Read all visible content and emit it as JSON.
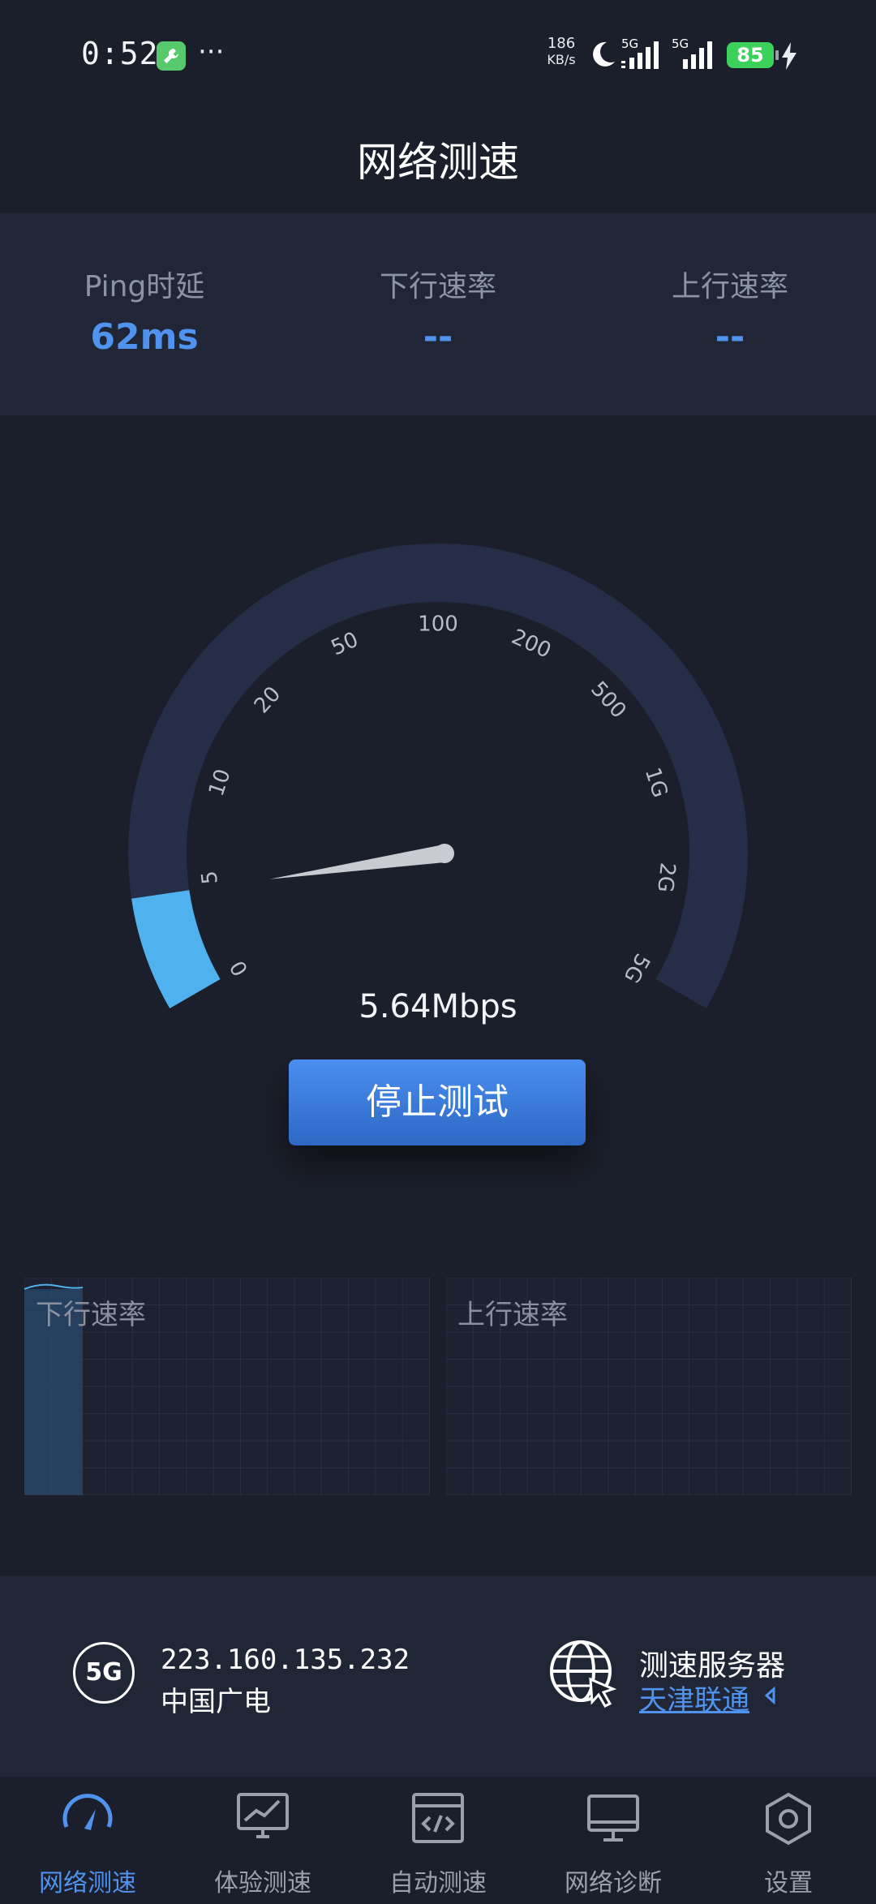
{
  "status_bar": {
    "time": "0:52",
    "more": "···",
    "net_speed_value": "186",
    "net_speed_unit": "KB/s",
    "sim1": "5G",
    "sim2": "5G",
    "battery": "85",
    "icons": [
      "wrench-app-icon",
      "moon-icon",
      "signal-icon",
      "battery-icon",
      "charging-bolt-icon"
    ]
  },
  "header": {
    "title": "网络测速"
  },
  "metrics": [
    {
      "label": "Ping时延",
      "value": "62ms"
    },
    {
      "label": "下行速率",
      "value": "--"
    },
    {
      "label": "上行速率",
      "value": "--"
    }
  ],
  "gauge": {
    "ticks": [
      "0",
      "5",
      "10",
      "20",
      "50",
      "100",
      "200",
      "500",
      "1G",
      "2G",
      "5G"
    ],
    "current_speed": "5.64Mbps",
    "progress_fraction": 0.09,
    "colors": {
      "track": "#252d47",
      "progress": "#4fb2ee",
      "needle": "#c8cbd2"
    }
  },
  "actions": {
    "stop_button": "停止测试"
  },
  "charts": {
    "download_label": "下行速率",
    "upload_label": "上行速率"
  },
  "info": {
    "ip": "223.160.135.232",
    "carrier": "中国广电",
    "badge": "5G",
    "server_label": "测速服务器",
    "server_name": "天津联通"
  },
  "bottom_nav": {
    "active_index": 0,
    "items": [
      {
        "label": "网络测速",
        "icon": "speedometer-icon"
      },
      {
        "label": "体验测速",
        "icon": "chart-monitor-icon"
      },
      {
        "label": "自动测速",
        "icon": "code-window-icon"
      },
      {
        "label": "网络诊断",
        "icon": "desktop-icon"
      },
      {
        "label": "设置",
        "icon": "hexagon-settings-icon"
      }
    ]
  },
  "accent_color": "#4f93ee"
}
